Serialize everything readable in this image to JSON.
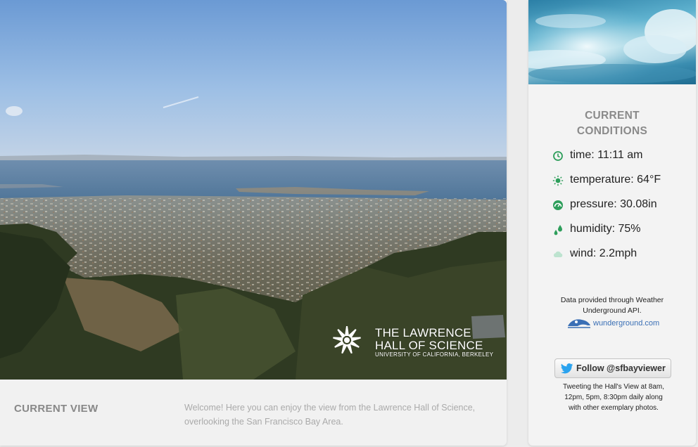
{
  "view": {
    "heading": "CURRENT VIEW",
    "description": "Welcome! Here you can enjoy the view from the Lawrence Hall of Science, overlooking the San Francisco Bay Area.",
    "logo": {
      "line1": "THE LAWRENCE",
      "line2": "HALL OF SCIENCE",
      "line3": "UNIVERSITY OF CALIFORNIA, BERKELEY"
    }
  },
  "conditions": {
    "title_line1": "CURRENT",
    "title_line2": "CONDITIONS",
    "items": [
      {
        "icon": "clock-icon",
        "label": "time: 11:11 am",
        "color": "#2e9e5b"
      },
      {
        "icon": "sun-icon",
        "label": "temperature: 64°F",
        "color": "#2e9e5b"
      },
      {
        "icon": "gauge-icon",
        "label": "pressure: 30.08in",
        "color": "#2e9e5b"
      },
      {
        "icon": "droplets-icon",
        "label": "humidity: 75%",
        "color": "#2e9e5b"
      },
      {
        "icon": "cloud-icon",
        "label": "wind: 2.2mph",
        "color": "#bde3cf"
      }
    ],
    "credit_line1": "Data provided through Weather",
    "credit_line2": "Underground API.",
    "wu_text": "wunderground.com"
  },
  "twitter": {
    "follow_label": "Follow @sfbayviewer",
    "note_line1": "Tweeting the Hall's View at 8am,",
    "note_line2": "12pm, 5pm, 8:30pm daily along",
    "note_line3": "with other exemplary photos."
  },
  "colors": {
    "accent_green": "#2e9e5b",
    "twitter_blue": "#2aa3ef",
    "wu_blue": "#3a6fb5"
  }
}
